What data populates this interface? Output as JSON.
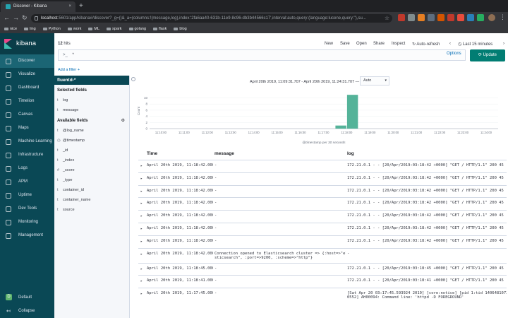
{
  "browser": {
    "tab_title": "Discover - Kibana",
    "tab_close": "×",
    "new_tab": "+",
    "url_host": "localhost",
    "url_rest": ":5601/app/kibana#/discover?_g=()&_a=(columns:!(message,log),index:'2fa6aa40-631b-11e9-8c96-db3b44566c17',interval:auto,query:(language:lucene,query:''),su...",
    "bookmarks": [
      "nice",
      "ling",
      "Python",
      "work",
      "ML",
      "spark",
      "golang",
      "flask",
      "blog"
    ],
    "colors": {
      "tabbar": "#202124",
      "toolbar": "#35363a"
    }
  },
  "kibana": {
    "brand": "kibana",
    "nav": [
      {
        "label": "Discover",
        "active": true
      },
      {
        "label": "Visualize"
      },
      {
        "label": "Dashboard"
      },
      {
        "label": "Timelion"
      },
      {
        "label": "Canvas"
      },
      {
        "label": "Maps"
      },
      {
        "label": "Machine Learning"
      },
      {
        "label": "Infrastructure"
      },
      {
        "label": "Logs"
      },
      {
        "label": "APM"
      },
      {
        "label": "Uptime"
      },
      {
        "label": "Dev Tools"
      },
      {
        "label": "Monitoring"
      },
      {
        "label": "Management"
      }
    ],
    "space_label": "Default",
    "space_avatar": "D",
    "collapse_label": "Collapse",
    "colors": {
      "sidebar": "#0a4855",
      "accent": "#017d73",
      "link": "#006bb4"
    }
  },
  "top": {
    "hits_count": "12",
    "hits_label": "hits",
    "menu": [
      "New",
      "Save",
      "Open",
      "Share",
      "Inspect"
    ],
    "auto_refresh": "Auto-refresh",
    "time_range": "Last 15 minutes"
  },
  "query": {
    "prefix": ">_",
    "value": "*",
    "options": "Options",
    "update": "Update",
    "add_filter": "Add a filter +"
  },
  "fields": {
    "index_pattern": "fluentd-*",
    "selected_header": "Selected fields",
    "selected": [
      {
        "type": "t",
        "name": "log"
      },
      {
        "type": "t",
        "name": "message"
      }
    ],
    "available_header": "Available fields",
    "available": [
      {
        "type": "t",
        "name": "@log_name"
      },
      {
        "type": "◷",
        "name": "@timestamp"
      },
      {
        "type": "t",
        "name": "_id"
      },
      {
        "type": "t",
        "name": "_index"
      },
      {
        "type": "#",
        "name": "_score"
      },
      {
        "type": "t",
        "name": "_type"
      },
      {
        "type": "t",
        "name": "container_id"
      },
      {
        "type": "t",
        "name": "container_name"
      },
      {
        "type": "t",
        "name": "source"
      }
    ]
  },
  "histogram": {
    "range_label": "April 20th 2019, 11:09:31.707 - April 20th 2019, 11:24:31.707 —",
    "interval": "Auto"
  },
  "chart_data": {
    "type": "bar",
    "categories": [
      "11:10:00",
      "11:11:00",
      "11:12:00",
      "11:13:00",
      "11:14:00",
      "11:15:00",
      "11:16:00",
      "11:17:00",
      "11:18:00",
      "11:19:00",
      "11:20:00",
      "11:21:00",
      "11:22:00",
      "11:23:00",
      "11:24:00"
    ],
    "bars": [
      {
        "x": "11:17:30",
        "value": 1
      },
      {
        "x": "11:18:00",
        "value": 11
      }
    ],
    "ylabel": "Count",
    "xlabel": "@timestamp per 30 seconds",
    "yticks": [
      0,
      2,
      4,
      6,
      8,
      10
    ],
    "ylim": [
      0,
      11.5
    ],
    "bar_color": "#54b399"
  },
  "table": {
    "columns": [
      "Time",
      "message",
      "log"
    ],
    "rows": [
      {
        "time": "April 20th 2019, 11:18:42.000",
        "message": "-",
        "log": "172.21.0.1 - - [20/Apr/2019:03:18:42 +0000] \"GET / HTTP/1.1\" 200 45"
      },
      {
        "time": "April 20th 2019, 11:18:42.000",
        "message": "-",
        "log": "172.21.0.1 - - [20/Apr/2019:03:18:42 +0000] \"GET / HTTP/1.1\" 200 45"
      },
      {
        "time": "April 20th 2019, 11:18:42.000",
        "message": "-",
        "log": "172.21.0.1 - - [20/Apr/2019:03:18:42 +0000] \"GET / HTTP/1.1\" 200 45"
      },
      {
        "time": "April 20th 2019, 11:18:42.000",
        "message": "-",
        "log": "172.21.0.1 - - [20/Apr/2019:03:18:42 +0000] \"GET / HTTP/1.1\" 200 45"
      },
      {
        "time": "April 20th 2019, 11:18:42.000",
        "message": "-",
        "log": "172.21.0.1 - - [20/Apr/2019:03:18:42 +0000] \"GET / HTTP/1.1\" 200 45"
      },
      {
        "time": "April 20th 2019, 11:18:42.000",
        "message": "-",
        "log": "172.21.0.1 - - [20/Apr/2019:03:18:42 +0000] \"GET / HTTP/1.1\" 200 45"
      },
      {
        "time": "April 20th 2019, 11:18:42.000",
        "message": "-",
        "log": "172.21.0.1 - - [20/Apr/2019:03:18:42 +0000] \"GET / HTTP/1.1\" 200 45"
      },
      {
        "time": "April 20th 2019, 11:18:42.000",
        "message": "Connection opened to Elasticsearch cluster => {:host=>\"ela\nsticsearch\", :port=>9200, :scheme=>\"http\"}",
        "log": "-"
      },
      {
        "time": "April 20th 2019, 11:18:45.000",
        "message": "-",
        "log": "172.21.0.1 - - [20/Apr/2019:03:18:45 +0000] \"GET / HTTP/1.1\" 200 45"
      },
      {
        "time": "April 20th 2019, 11:18:41.000",
        "message": "-",
        "log": "172.21.0.1 - - [20/Apr/2019:03:18:41 +0000] \"GET / HTTP/1.1\" 200 45"
      },
      {
        "time": "April 20th 2019, 11:17:45.000",
        "message": "-",
        "log": "[Sat Apr 20 03:17:45.593924 2019] [core:notice] [pid 1:tid 14064810728\n0552] AH00094: Command line: 'httpd -D FOREGROUND'"
      }
    ]
  }
}
